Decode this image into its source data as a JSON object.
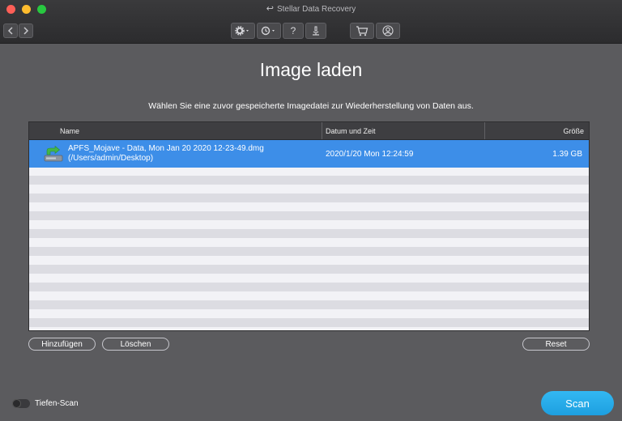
{
  "window": {
    "title": "Stellar Data Recovery"
  },
  "toolbar": {
    "icons": [
      "settings-icon",
      "history-icon",
      "help-icon",
      "microscope-icon",
      "cart-icon",
      "user-icon"
    ],
    "help_glyph": "?"
  },
  "main": {
    "title": "Image laden",
    "subtitle": "Wählen Sie eine zuvor gespeicherte Imagedatei zur Wiederherstellung von Daten aus."
  },
  "table": {
    "columns": {
      "name": "Name",
      "date": "Datum und Zeit",
      "size": "Größe"
    },
    "rows": [
      {
        "name_line1": "APFS_Mojave - Data, Mon Jan 20 2020 12-23-49.dmg",
        "name_line2": "(/Users/admin/Desktop)",
        "date": "2020/1/20 Mon 12:24:59",
        "size": "1.39 GB",
        "selected": true
      }
    ]
  },
  "buttons": {
    "add": "Hinzufügen",
    "delete": "Löschen",
    "reset": "Reset",
    "scan": "Scan"
  },
  "deep_scan": {
    "label": "Tiefen-Scan",
    "enabled": false
  },
  "colors": {
    "background": "#5b5b5e",
    "selection": "#3d8ee8",
    "scan_button": "#1da6e8"
  }
}
